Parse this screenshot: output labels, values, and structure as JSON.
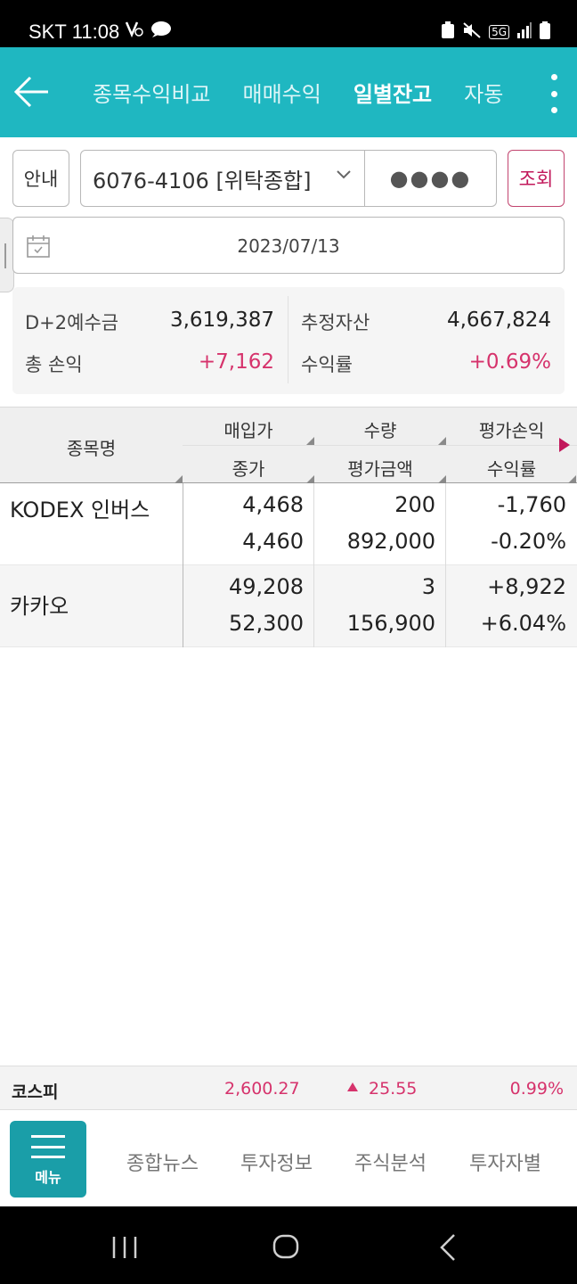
{
  "status_bar": {
    "carrier": "SKT",
    "time": "11:08",
    "network": "5G"
  },
  "header": {
    "tabs": [
      {
        "label": "종목수익비교",
        "active": false
      },
      {
        "label": "매매수익",
        "active": false
      },
      {
        "label": "일별잔고",
        "active": true
      },
      {
        "label": "자동",
        "active": false
      }
    ],
    "accent_color": "#1fb7c1"
  },
  "controls": {
    "info_label": "안내",
    "account": "6076-4106 [위탁종합]",
    "password_mask": "●●●●",
    "search_label": "조회",
    "date": "2023/07/13"
  },
  "summary": {
    "deposit_label": "D+2예수금",
    "deposit_value": "3,619,387",
    "estimated_assets_label": "추정자산",
    "estimated_assets_value": "4,667,824",
    "total_pl_label": "총 손익",
    "total_pl_value": "+7,162",
    "return_label": "수익률",
    "return_value": "+0.69%"
  },
  "table": {
    "headers": {
      "name": "종목명",
      "buy_price": "매입가",
      "close_price": "종가",
      "quantity": "수량",
      "eval_amount": "평가금액",
      "eval_pl": "평가손익",
      "return_rate": "수익률"
    },
    "rows": [
      {
        "name": "KODEX 인버스",
        "buy_price": "4,468",
        "quantity": "200",
        "eval_pl": "-1,760",
        "close_price": "4,460",
        "eval_amount": "892,000",
        "return_rate": "-0.20%",
        "sign": "neg"
      },
      {
        "name": "카카오",
        "buy_price": "49,208",
        "quantity": "3",
        "eval_pl": "+8,922",
        "close_price": "52,300",
        "eval_amount": "156,900",
        "return_rate": "+6.04%",
        "sign": "pos"
      }
    ]
  },
  "index_bar": {
    "name": "코스피",
    "value": "2,600.27",
    "change": "25.55",
    "change_pct": "0.99%",
    "direction": "up"
  },
  "bottom_nav": {
    "menu_label": "메뉴",
    "links": [
      "종합뉴스",
      "투자정보",
      "주식분석",
      "투자자별"
    ]
  },
  "colors": {
    "positive": "#d6336c",
    "negative": "#2c58c8",
    "menu_button": "#1a9ea8"
  }
}
